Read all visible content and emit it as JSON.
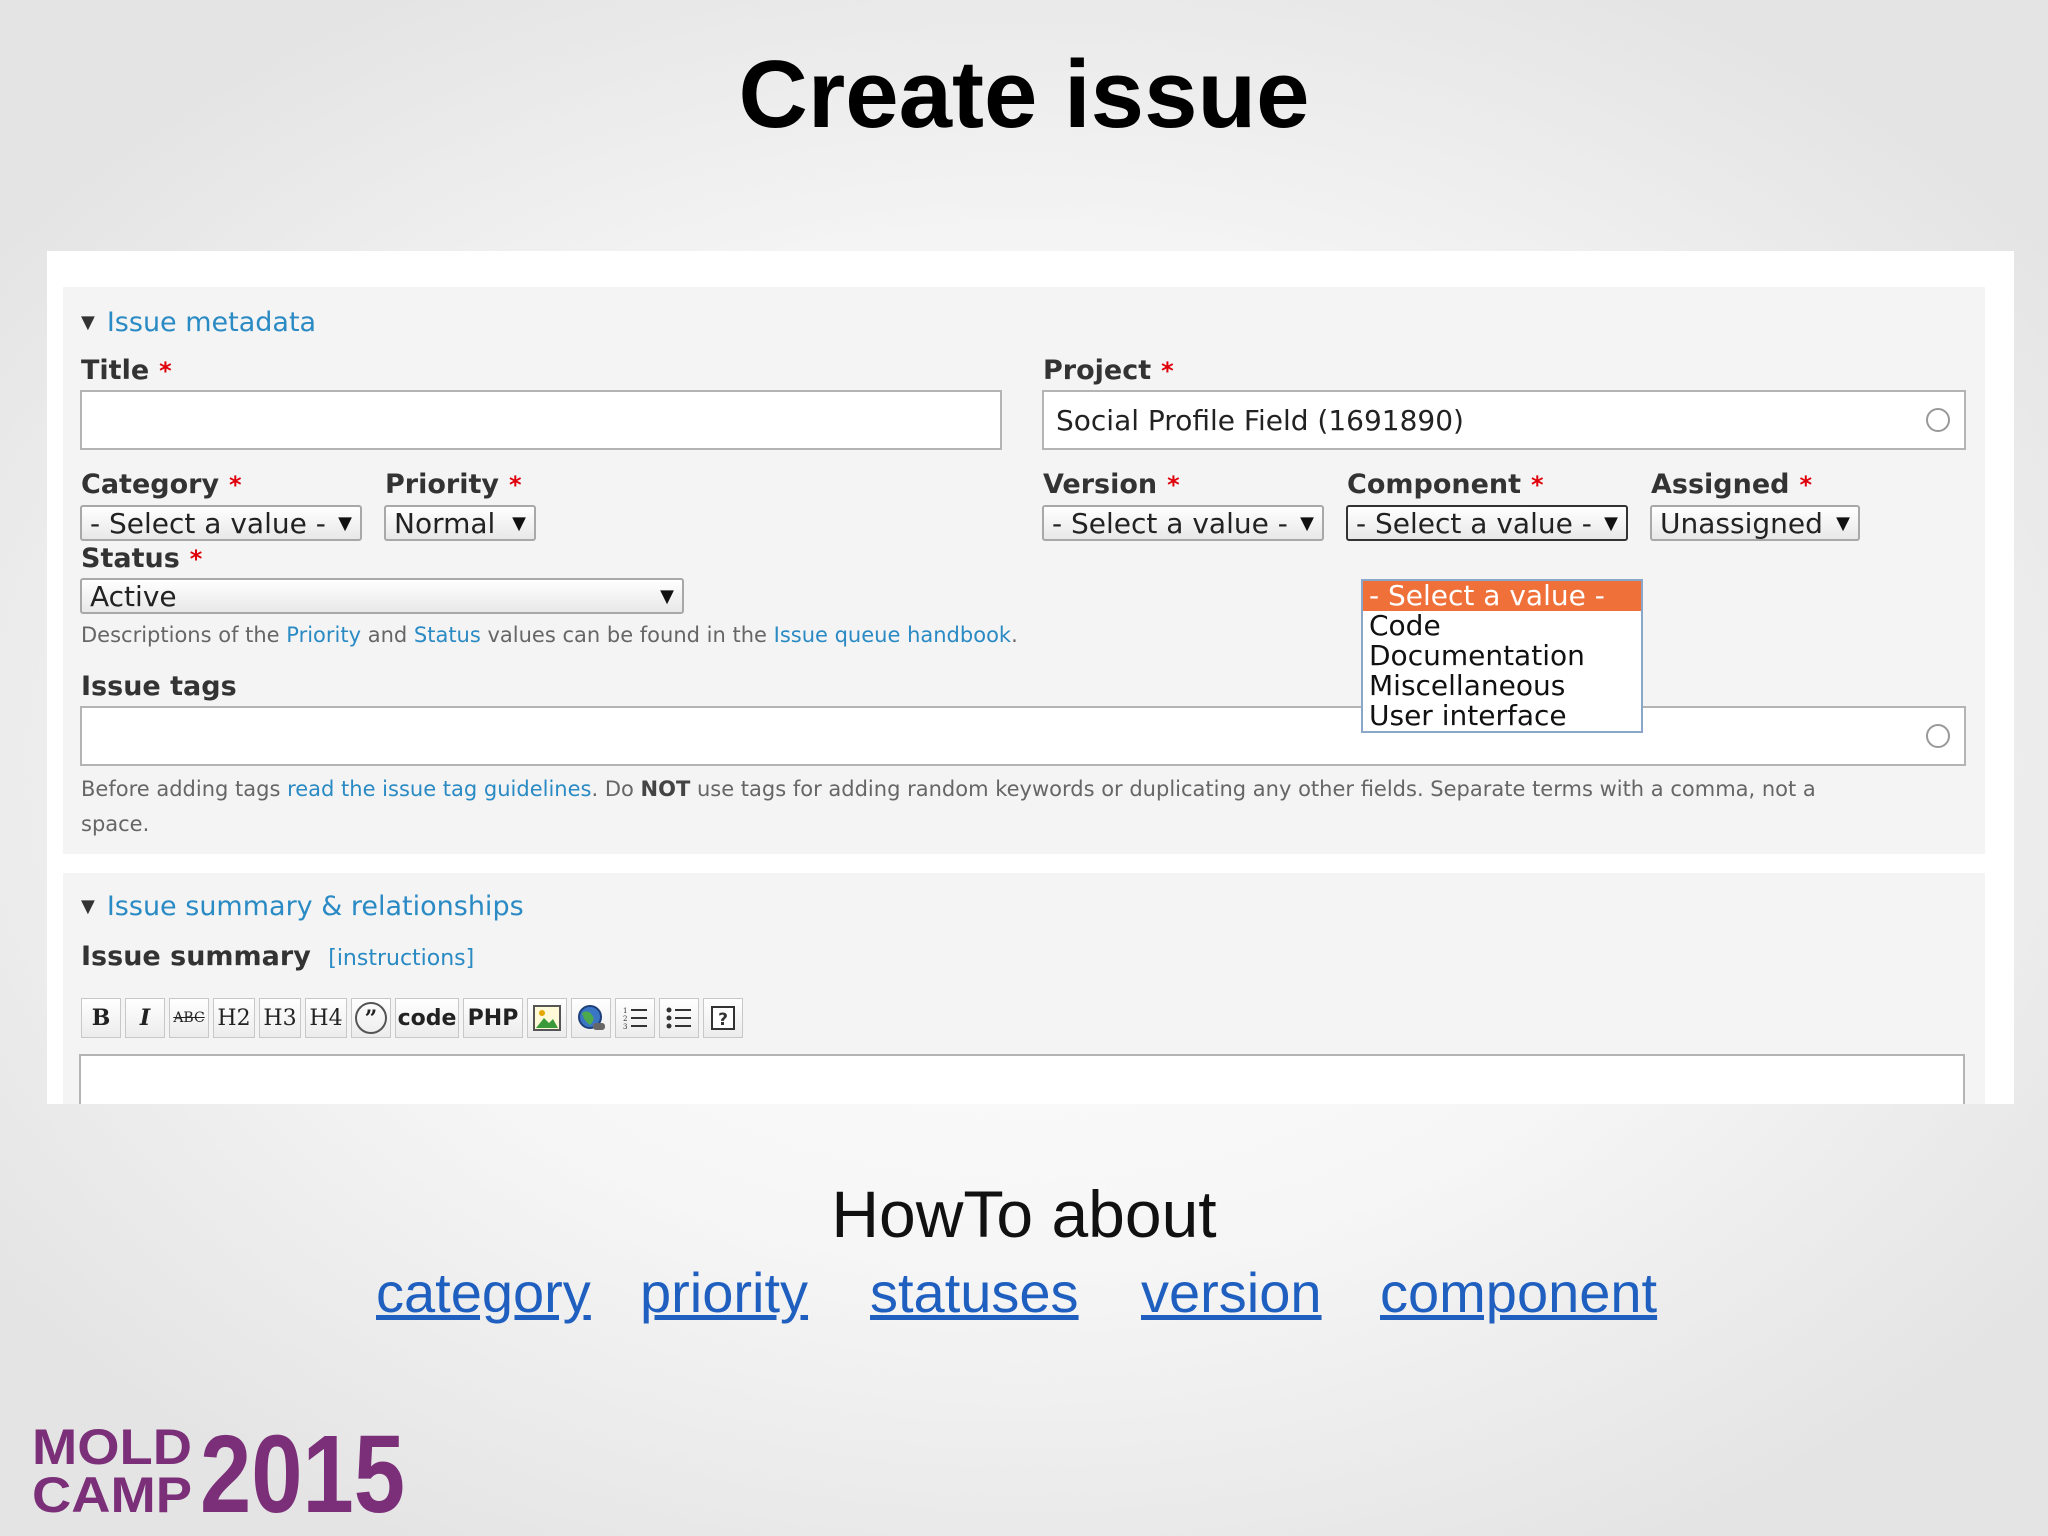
{
  "slide": {
    "title": "Create issue",
    "howto": {
      "title": "HowTo about",
      "links": [
        "category",
        "priority",
        "statuses",
        "version",
        "component"
      ]
    },
    "logo": {
      "line1": "MOLD",
      "line2": "CAMP",
      "year": "2015",
      "color": "#7a2f78"
    }
  },
  "form": {
    "metadata_legend": "Issue metadata",
    "required_mark": "*",
    "title_label": "Title",
    "title_value": "",
    "project_label": "Project",
    "project_value": "Social Profile Field (1691890)",
    "category_label": "Category",
    "category_value": "- Select a value -",
    "priority_label": "Priority",
    "priority_value": "Normal",
    "version_label": "Version",
    "version_value": "- Select a value -",
    "component_label": "Component",
    "component_value": "- Select a value -",
    "assigned_label": "Assigned",
    "assigned_value": "Unassigned",
    "status_label": "Status",
    "status_value": "Active",
    "status_desc": {
      "p1": "Descriptions of the ",
      "link1": "Priority",
      "p2": " and ",
      "link2": "Status",
      "p3": " values can be found in the ",
      "link3": "Issue queue handbook",
      "p4": "."
    },
    "component_options": [
      "- Select a value -",
      "Code",
      "Documentation",
      "Miscellaneous",
      "User interface"
    ],
    "tags_label": "Issue tags",
    "tags_value": "",
    "tags_desc": {
      "p1": "Before adding tags ",
      "link": "read the issue tag guidelines",
      "p2": ". Do ",
      "strong": "NOT",
      "p3": " use tags for adding random keywords or duplicating any other fields. Separate terms with a comma, not a",
      "p4": "space."
    },
    "summary_legend": "Issue summary & relationships",
    "summary_label": "Issue summary",
    "summary_instructions": "[instructions]",
    "toolbar": {
      "bold": "B",
      "italic": "I",
      "strike": "ABC",
      "h2": "H2",
      "h3": "H3",
      "h4": "H4",
      "quote": "”",
      "code": "code",
      "php": "PHP"
    }
  },
  "colors": {
    "link": "#2a8ac4",
    "required": "#e0000a",
    "highlight": "#f0703a"
  }
}
